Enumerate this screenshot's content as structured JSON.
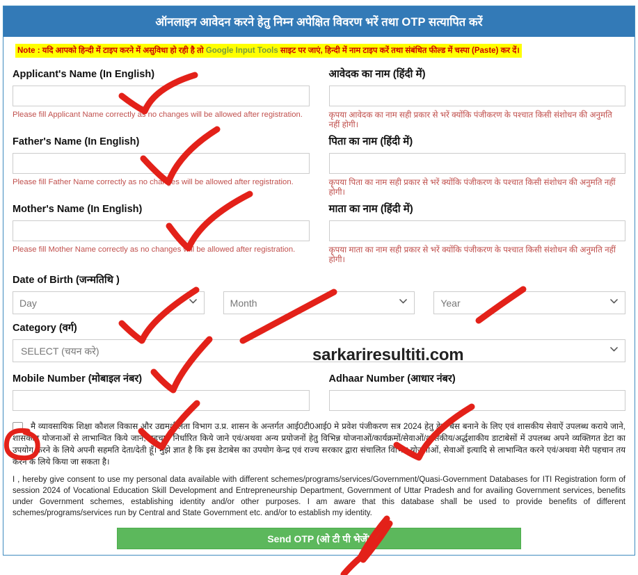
{
  "header": {
    "title": "ऑनलाइन आवेदन करने हेतु निम्न अपेक्षित विवरण भरें तथा OTP सत्यापित करें"
  },
  "note": {
    "prefix": "Note : यदि आपको हिन्दी में टाइप करने में असुविधा हो रही है तो ",
    "link": "Google Input Tools",
    "suffix": " साइट पर जाएं, हिन्दी में नाम टाइप करें तथा संबंधित फील्ड में चस्पा (Paste) कर दें।"
  },
  "fields": {
    "applicant_en": {
      "label": "Applicant's Name (In English)",
      "value": "",
      "placeholder": "",
      "hint": "Please fill Applicant Name correctly as no changes will be allowed after registration."
    },
    "applicant_hi": {
      "label": "आवेदक का नाम (हिंदी में)",
      "value": "",
      "placeholder": "",
      "hint": "कृपया आवेदक का नाम सही प्रकार से भरें क्योंकि पंजीकरण के पश्चात किसी संशोधन की अनुमति नहीं होगी।"
    },
    "father_en": {
      "label": "Father's Name (In English)",
      "value": "",
      "placeholder": "",
      "hint": "Please fill Father Name correctly as no changes will be allowed after registration."
    },
    "father_hi": {
      "label": "पिता का नाम (हिंदी में)",
      "value": "",
      "placeholder": "",
      "hint": "कृपया पिता का नाम सही प्रकार से भरें क्योंकि पंजीकरण के पश्चात किसी संशोधन की अनुमति नहीं होगी।"
    },
    "mother_en": {
      "label": "Mother's Name (In English)",
      "value": "",
      "placeholder": "",
      "hint": "Please fill Mother Name correctly as no changes will be allowed after registration."
    },
    "mother_hi": {
      "label": "माता का नाम (हिंदी में)",
      "value": "",
      "placeholder": "",
      "hint": "कृपया माता का नाम सही प्रकार से भरें क्योंकि पंजीकरण के पश्चात किसी संशोधन की अनुमति नहीं होगी।"
    },
    "dob": {
      "label": "Date of Birth (जन्मतिथि )",
      "day_selected": "Day",
      "month_selected": "Month",
      "year_selected": "Year"
    },
    "category": {
      "label": "Category (वर्ग)",
      "selected": "SELECT (चयन करे)"
    },
    "mobile": {
      "label": "Mobile Number (मोबाइल नंबर)",
      "value": "",
      "placeholder": ""
    },
    "adhaar": {
      "label": "Adhaar Number (आधार नंबर)",
      "value": "",
      "placeholder": ""
    }
  },
  "consent": {
    "hindi": "मै व्यावसायिक शिक्षा कौशल विकास और उद्यमशीलता विभाग उ.प्र. शासन के अन्तर्गत आई0टी0आई0 मे प्रवेश पंजीकरण सत्र 2024 हेतु डेटा बेस बनाने के लिए एवं शासकीय सेवाऐं उपलब्ध कराये जाने, शासकीय योजनाओं से लाभान्वित किये जाने, पहचान निर्धारित किये जाने एवं/अथवा अन्य प्रयोजनों हेतु विभिन्न योजनाओं/कार्यक्रमों/सेवाओं/शासकीय/अर्द्धशाकीय डाटाबेसों में उपलब्ध अपने व्यक्तिगत डेटा का उपयोग करने के लिये अपनी सहमति देता/देती हूँ। मुझे ज्ञात है कि इस डेटाबेस का उपयोग केन्द्र एवं राज्य सरकार द्वारा संचालित विभिन्न योजनाओं, सेवाओं इत्यादि से लाभान्वित करने एवं/अथवा मेरी पहचान तय करने के लिये किया जा सकता है।",
    "english": "I , hereby give consent to use my personal data available with different schemes/programs/services/Government/Quasi-Government Databases for ITI Registration form of session 2024 of Vocational Education Skill Development and Entrepreneurship Department, Government of Uttar Pradesh and for availing Government services, benefits under Government schemes, establishing identity and/or other purposes. I am aware that this database shall be used to provide benefits of different schemes/programs/services run by Central and State Government etc. and/or to establish my identity.",
    "checked": false
  },
  "actions": {
    "send_otp": "Send OTP (ओ टी पी भेजें)"
  },
  "watermark": "sarkariresultiti.com",
  "colors": {
    "header_blue": "#337ab7",
    "note_bg": "#ffff00",
    "note_text": "#cc0000",
    "link_green": "#7a9b3a",
    "hint_red": "#c0504d",
    "button_green": "#5cb85c",
    "annotation_red": "#e32119"
  }
}
